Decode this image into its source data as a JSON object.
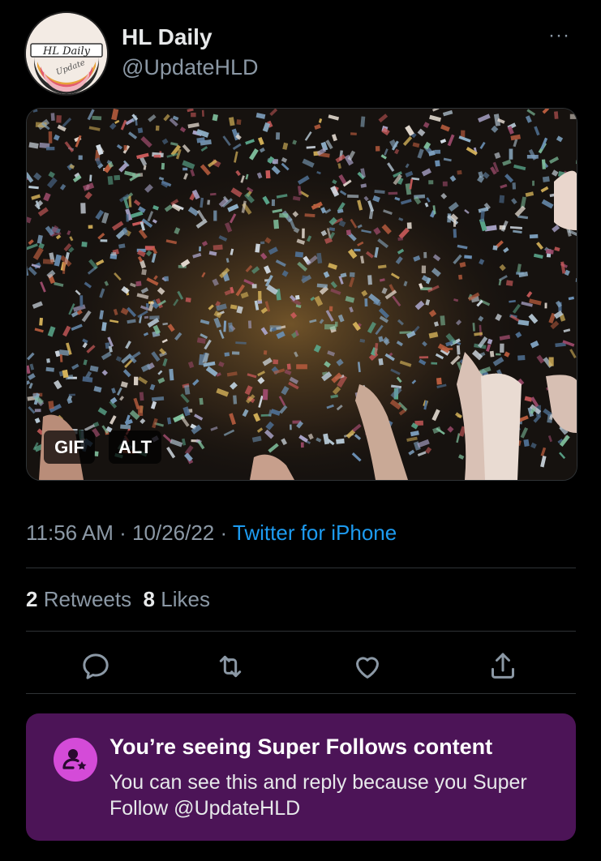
{
  "tweet": {
    "author_name": "HL Daily",
    "author_handle": "@UpdateHLD",
    "more_label": "···",
    "avatar_text": "HL Daily",
    "avatar_subtext": "Update",
    "media": {
      "gif_badge": "GIF",
      "alt_badge": "ALT"
    },
    "time": "11:56 AM",
    "date": "10/26/22",
    "separator": " · ",
    "source": "Twitter for iPhone",
    "retweets_count": "2",
    "retweets_label": "Retweets",
    "likes_count": "8",
    "likes_label": "Likes"
  },
  "actions": {
    "icons": [
      "reply-icon",
      "retweet-icon",
      "like-icon",
      "share-icon"
    ]
  },
  "super_follows": {
    "title": "You’re seeing Super Follows content",
    "body": "You can see this and reply because you Super Follow @UpdateHLD"
  },
  "colors": {
    "background": "#000000",
    "accent_blue": "#1d9bf0",
    "secondary_text": "#8b98a5",
    "super_follows_bg": "#4c1457",
    "super_follows_icon": "#d44bd8"
  }
}
